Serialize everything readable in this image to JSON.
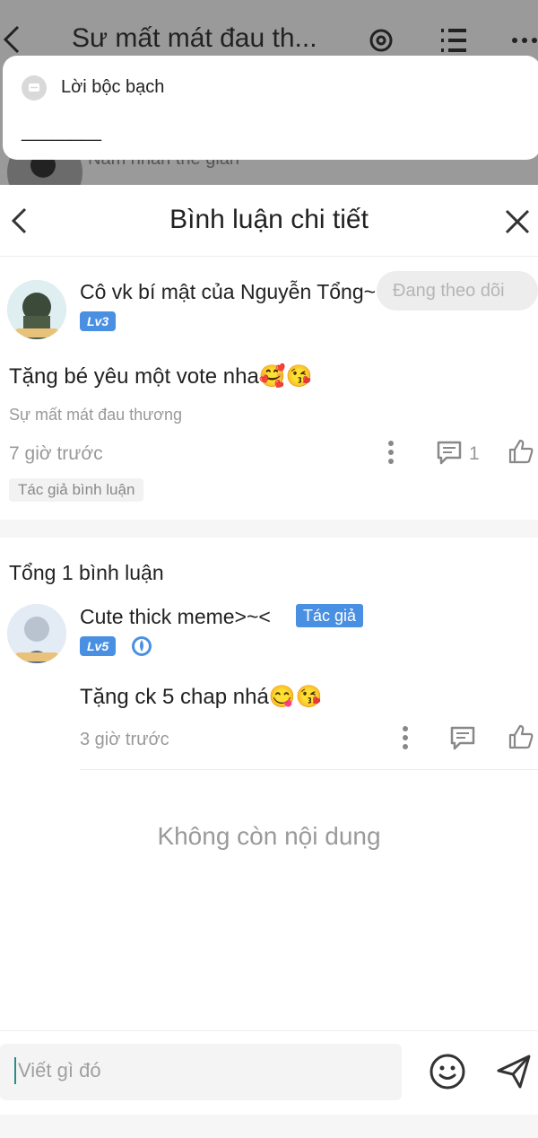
{
  "background": {
    "title": "Sư mất mát đau th...",
    "author_partial": "Nam nhân thế gian"
  },
  "popup": {
    "title": "Lời bộc bạch",
    "line": "________"
  },
  "sheet": {
    "title": "Bình luận chi tiết"
  },
  "main_comment": {
    "user": "Cô vk bí mật của Nguyễn Tổng~",
    "level": "Lv3",
    "follow_label": "Đang theo dõi",
    "text": "Tặng bé yêu một vote nha🥰😘",
    "book": "Sự mất mát đau thương",
    "time": "7 giờ trước",
    "reply_count": "1",
    "tag": "Tác giả bình luận"
  },
  "replies": {
    "total": "Tổng 1 bình luận",
    "items": [
      {
        "user": "Cute thick meme>~<",
        "badge": "Tác giả",
        "level": "Lv5",
        "text": "Tặng ck 5 chap nhá😋😘",
        "time": "3 giờ trước"
      }
    ]
  },
  "empty_text": "Không còn nội dung",
  "composer": {
    "placeholder": "Viết gì đó"
  },
  "colors": {
    "accent": "#4a90e2",
    "overlay": "#9a9a9a"
  }
}
